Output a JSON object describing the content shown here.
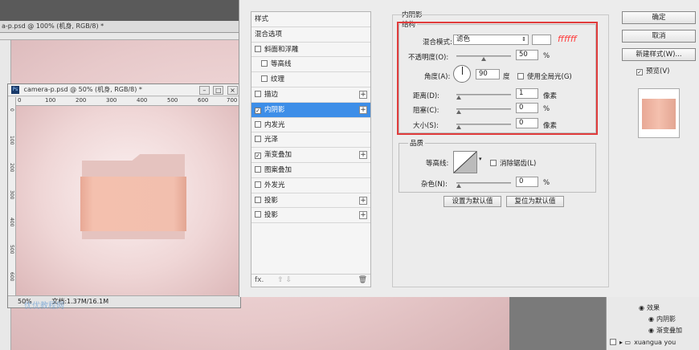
{
  "background_doc": {
    "tab_title": "a-p.psd @ 100% (机身, RGB/8) *"
  },
  "doc_window": {
    "title": "camera-p.psd @ 50% (机身, RGB/8) *",
    "window_buttons": [
      "–",
      "□",
      "×"
    ],
    "ruler_top": [
      "0",
      "100",
      "200",
      "300",
      "400",
      "500",
      "600",
      "700"
    ],
    "ruler_left": [
      "0",
      "100",
      "200",
      "300",
      "400",
      "500",
      "600"
    ],
    "zoom": "50%",
    "doc_size": "文档:1.37M/16.1M",
    "watermark": "优优教程网"
  },
  "style_list": {
    "items": [
      {
        "label": "样式",
        "checkbox": false,
        "plus": false,
        "sub": false,
        "checked": false,
        "selected": false
      },
      {
        "label": "混合选项",
        "checkbox": false,
        "plus": false,
        "sub": false,
        "checked": false,
        "selected": false
      },
      {
        "label": "斜面和浮雕",
        "checkbox": true,
        "plus": false,
        "sub": false,
        "checked": false,
        "selected": false
      },
      {
        "label": "等高线",
        "checkbox": true,
        "plus": false,
        "sub": true,
        "checked": false,
        "selected": false
      },
      {
        "label": "纹理",
        "checkbox": true,
        "plus": false,
        "sub": true,
        "checked": false,
        "selected": false
      },
      {
        "label": "描边",
        "checkbox": true,
        "plus": true,
        "sub": false,
        "checked": false,
        "selected": false
      },
      {
        "label": "内阴影",
        "checkbox": true,
        "plus": true,
        "sub": false,
        "checked": true,
        "selected": true
      },
      {
        "label": "内发光",
        "checkbox": true,
        "plus": false,
        "sub": false,
        "checked": false,
        "selected": false
      },
      {
        "label": "光泽",
        "checkbox": true,
        "plus": false,
        "sub": false,
        "checked": false,
        "selected": false
      },
      {
        "label": "渐变叠加",
        "checkbox": true,
        "plus": true,
        "sub": false,
        "checked": true,
        "selected": false
      },
      {
        "label": "图案叠加",
        "checkbox": true,
        "plus": false,
        "sub": false,
        "checked": false,
        "selected": false
      },
      {
        "label": "外发光",
        "checkbox": true,
        "plus": false,
        "sub": false,
        "checked": false,
        "selected": false
      },
      {
        "label": "投影",
        "checkbox": true,
        "plus": true,
        "sub": false,
        "checked": false,
        "selected": false
      },
      {
        "label": "投影",
        "checkbox": true,
        "plus": true,
        "sub": false,
        "checked": false,
        "selected": false
      }
    ],
    "footer_fx": "fx.",
    "footer_arrows": "⇧ ⇩",
    "footer_trash": "🗑"
  },
  "inner_shadow": {
    "title": "内阴影",
    "structure_legend": "结构",
    "blend_mode_label": "混合模式:",
    "blend_mode_value": "滤色",
    "color_hex": "ffffff",
    "opacity_label": "不透明度(O):",
    "opacity_value": "50",
    "opacity_unit": "%",
    "angle_label": "角度(A):",
    "angle_value": "90",
    "angle_unit": "度",
    "global_light_label": "使用全局光(G)",
    "distance_label": "距离(D):",
    "distance_value": "1",
    "distance_unit": "像素",
    "choke_label": "阻塞(C):",
    "choke_value": "0",
    "choke_unit": "%",
    "size_label": "大小(S):",
    "size_value": "0",
    "size_unit": "像素",
    "quality_legend": "品质",
    "contour_label": "等高线:",
    "antialias_label": "消除锯齿(L)",
    "noise_label": "杂色(N):",
    "noise_value": "0",
    "noise_unit": "%",
    "set_default": "设置为默认值",
    "reset_default": "复位为默认值"
  },
  "side_buttons": {
    "ok": "确定",
    "cancel": "取消",
    "new_style": "新建样式(W)...",
    "preview": "预览(V)"
  },
  "layers": {
    "effects": "效果",
    "inner_shadow": "内阴影",
    "gradient_overlay": "渐变叠加",
    "group": "xuangua you"
  }
}
